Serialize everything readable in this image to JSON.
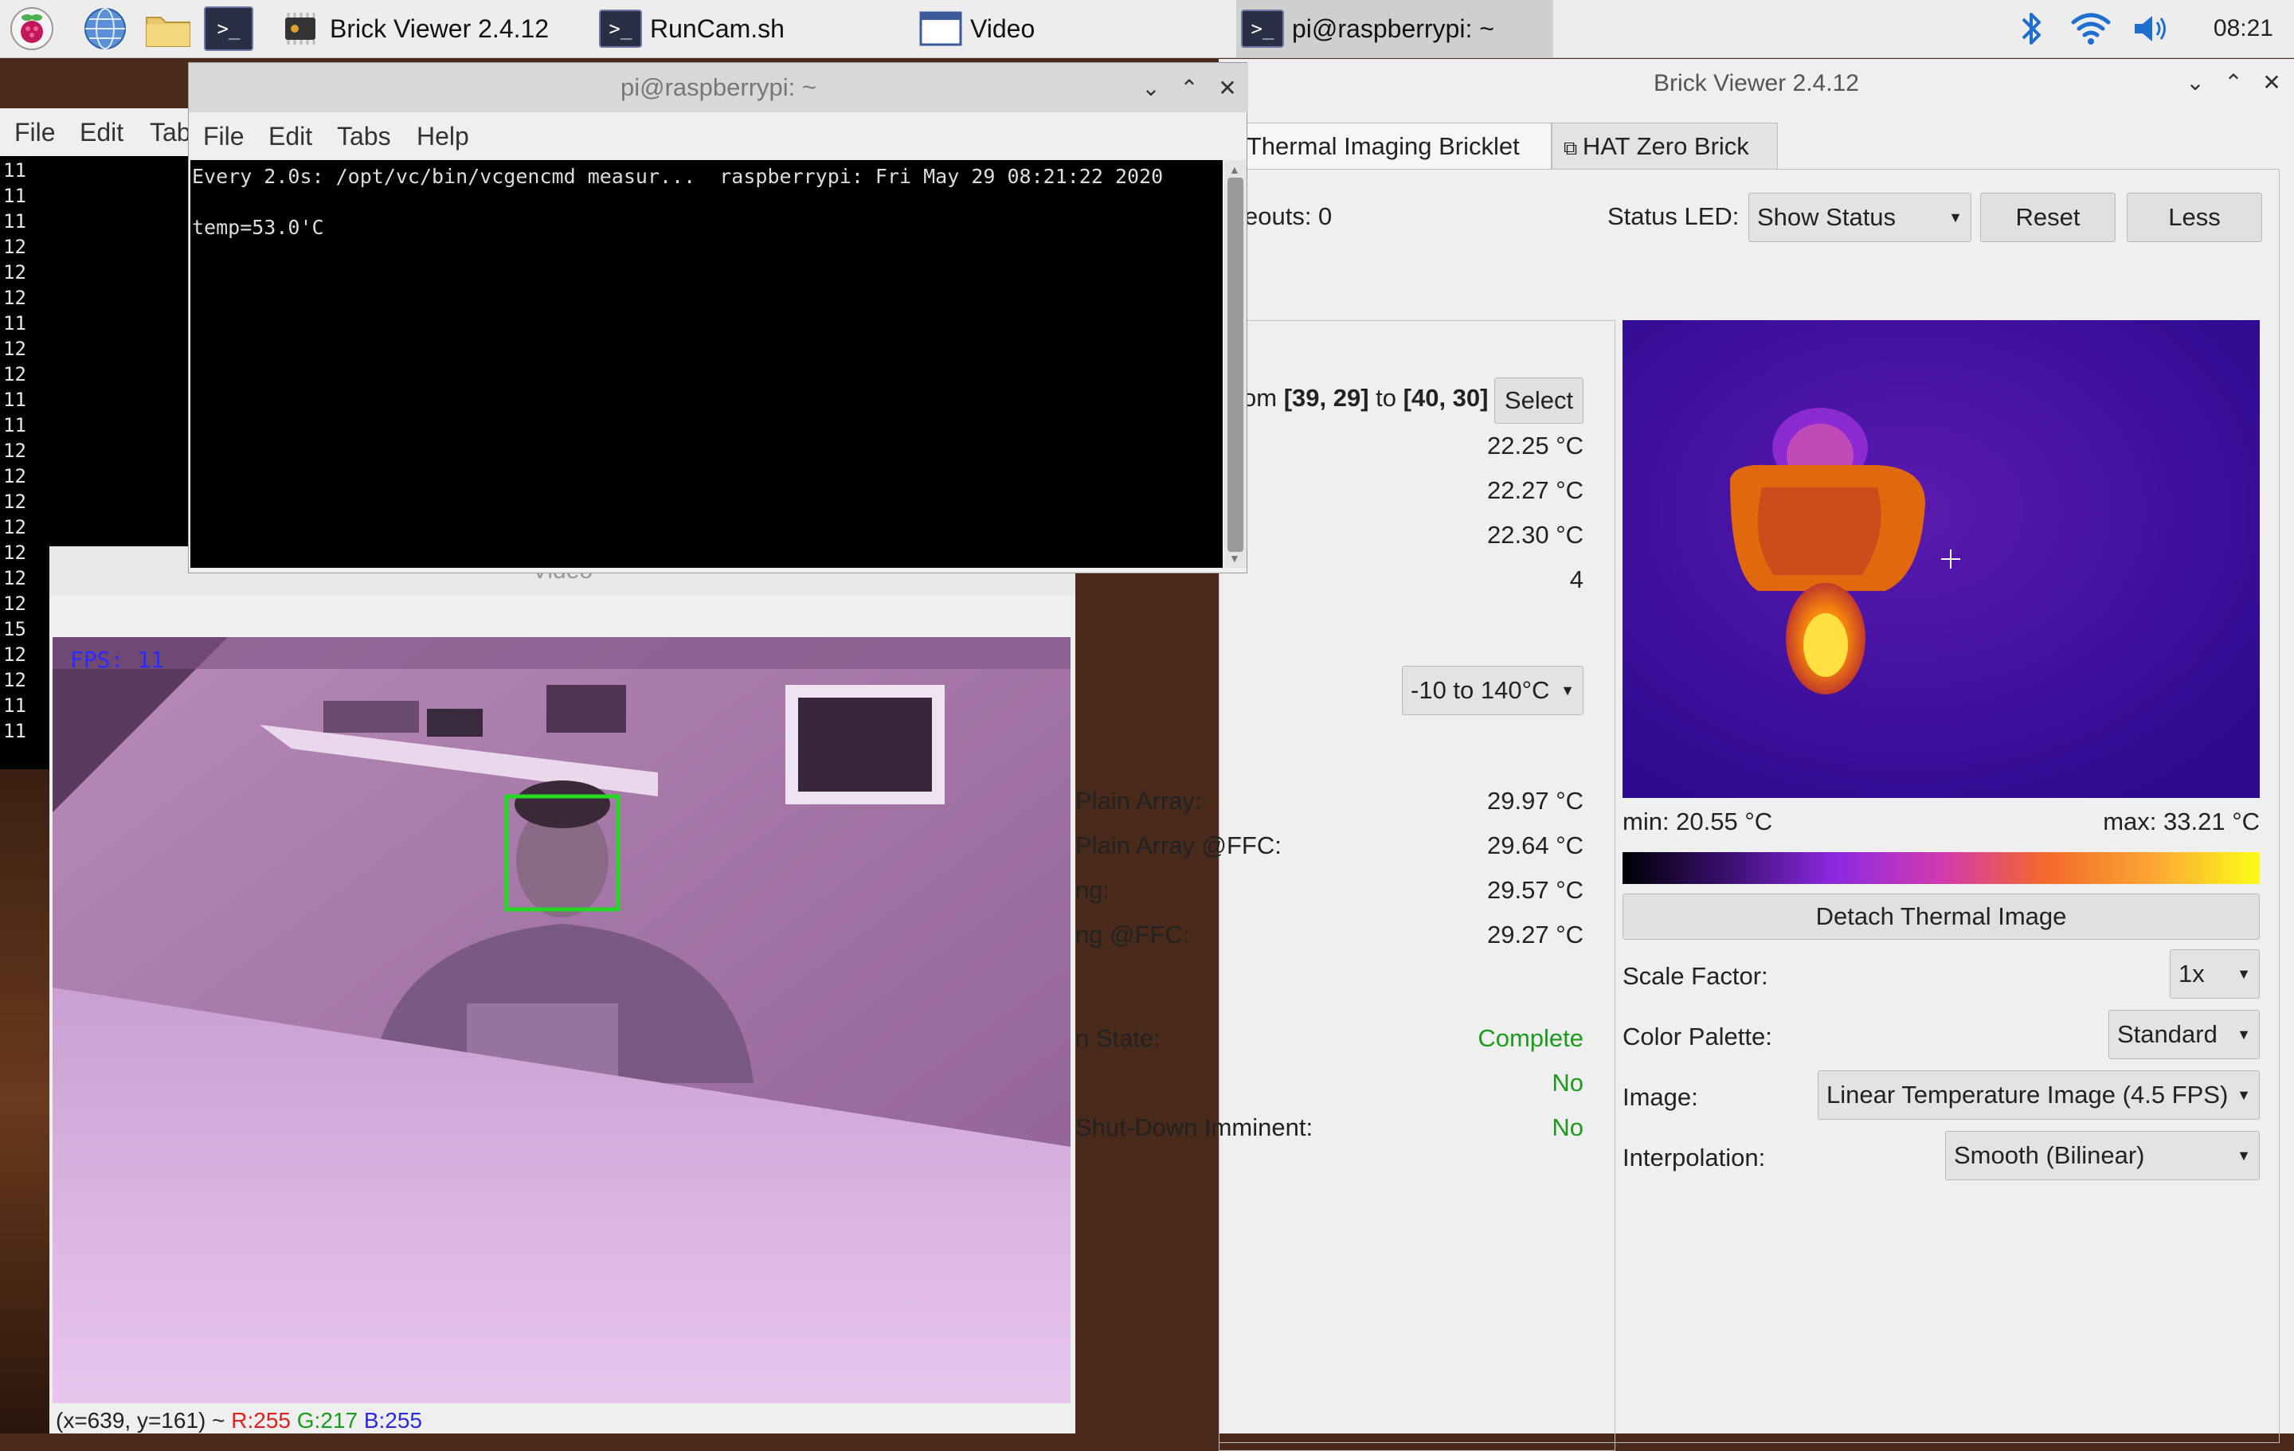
{
  "taskbar": {
    "apps": [
      {
        "label": "Brick Viewer 2.4.12"
      },
      {
        "label": "RunCam.sh"
      },
      {
        "label": "Video"
      },
      {
        "label": "pi@raspberrypi: ~"
      }
    ],
    "clock": "08:21"
  },
  "brick_viewer": {
    "title": "Brick Viewer 2.4.12",
    "tabs": [
      {
        "label": "Thermal Imaging Bricklet"
      },
      {
        "label": "HAT Zero Brick"
      }
    ],
    "timeouts": "eouts: 0",
    "status_led_label": "Status LED:",
    "status_led_value": "Show Status",
    "reset_label": "Reset",
    "less_label": "Less",
    "region": {
      "prefix": "om",
      "from": "[39, 29]",
      "to_word": "to",
      "to": "[40, 30]",
      "select_label": "Select"
    },
    "region_values": [
      "22.25 °C",
      "22.27 °C",
      "22.30 °C",
      "4"
    ],
    "range_value": "-10 to 140°C",
    "flux_rows": [
      {
        "label": "Plain Array:",
        "value": "29.97 °C"
      },
      {
        "label": "Plain Array @FFC:",
        "value": "29.64 °C"
      },
      {
        "label": "ng:",
        "value": "29.57 °C"
      },
      {
        "label": "ng @FFC:",
        "value": "29.27 °C"
      }
    ],
    "state_rows": [
      {
        "label": "n State:",
        "value": "Complete"
      },
      {
        "label": "",
        "value": "No"
      },
      {
        "label": "Shut-Down Imminent:",
        "value": "No"
      }
    ],
    "thermal": {
      "min_label": "min: 20.55 °C",
      "max_label": "max: 33.21 °C",
      "detach_label": "Detach Thermal Image",
      "scale_factor_label": "Scale Factor:",
      "scale_factor_value": "1x",
      "color_palette_label": "Color Palette:",
      "color_palette_value": "Standard",
      "image_label": "Image:",
      "image_value": "Linear Temperature Image (4.5 FPS)",
      "interpolation_label": "Interpolation:",
      "interpolation_value": "Smooth (Bilinear)"
    }
  },
  "terminal": {
    "title": "pi@raspberrypi: ~",
    "menu": [
      "File",
      "Edit",
      "Tabs",
      "Help"
    ],
    "line1": "Every 2.0s: /opt/vc/bin/vcgencmd measur...  raspberrypi: Fri May 29 08:21:22 2020",
    "line2": "temp=53.0'C"
  },
  "back_terminal": {
    "menu": [
      "File",
      "Edit",
      "Tab"
    ],
    "lines": [
      "11",
      "11",
      "11",
      "12",
      "12",
      "12",
      "11",
      "12",
      "12",
      "11",
      "11",
      "12",
      "12",
      "12",
      "12",
      "12",
      "12",
      "12",
      "15",
      "12",
      "12",
      "11",
      "11"
    ]
  },
  "video": {
    "title": "Video",
    "fps": "FPS: 11",
    "status": {
      "coords": "(x=639, y=161) ~",
      "r": "R:255",
      "g": "G:217",
      "b": "B:255"
    }
  },
  "colors": {
    "accent_green": "#1b9a1b",
    "face_box": "#23d923",
    "fps_text": "#2a2aff"
  }
}
